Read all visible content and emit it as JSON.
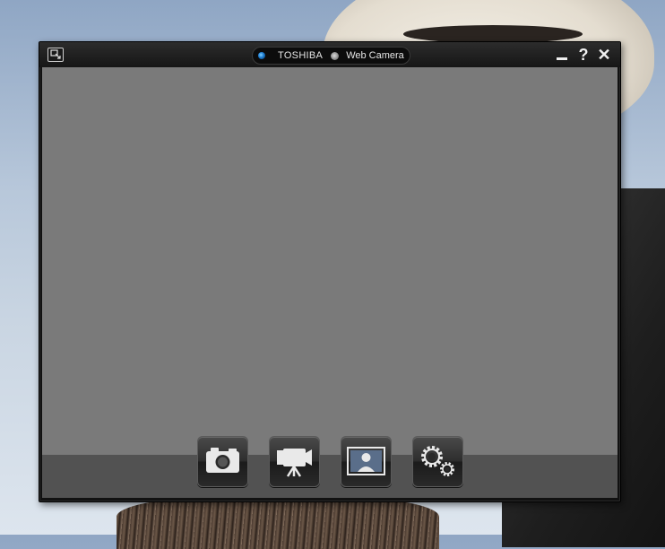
{
  "title_bar": {
    "brand": "TOSHIBA",
    "product": "Web Camera",
    "left_icon": "window-mode-icon",
    "minimize_icon": "minimize-icon",
    "help_label": "?",
    "close_label": "✕"
  },
  "toolbar": {
    "buttons": [
      {
        "icon": "camera-icon"
      },
      {
        "icon": "video-camera-icon"
      },
      {
        "icon": "portrait-frame-icon"
      },
      {
        "icon": "settings-gears-icon"
      }
    ]
  },
  "colors": {
    "viewport": "#7a7a7a",
    "toolbar": "#525252",
    "window_frame": "#111111",
    "status_dot": "#1c7bd0"
  }
}
